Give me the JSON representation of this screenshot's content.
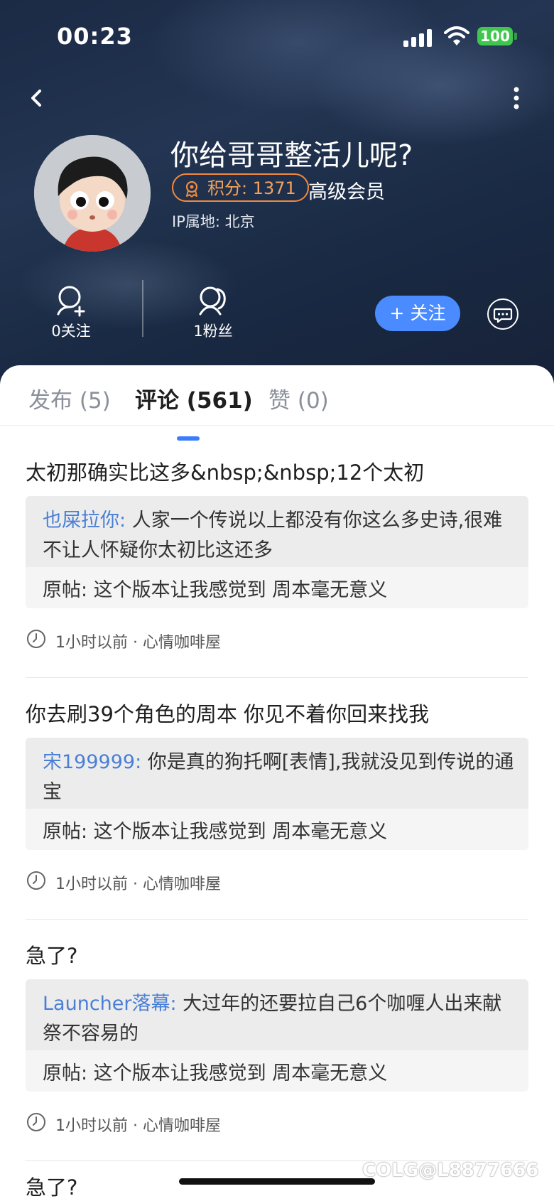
{
  "status_bar": {
    "time": "00:23",
    "battery": "100"
  },
  "profile": {
    "nickname": "你给哥哥整活儿呢?",
    "points": "积分: 1371",
    "level": "高级会员",
    "ip": "IP属地: 北京",
    "following": "0关注",
    "fans": "1粉丝",
    "follow_button": "+ 关注"
  },
  "tabs": [
    {
      "label": "发布 (5)"
    },
    {
      "label": "评论 (561)"
    },
    {
      "label": "赞 (0)"
    }
  ],
  "comments": [
    {
      "text": "太初那确实比这多&nbsp;&nbsp;12个太初",
      "reply_user": "也屎拉你:",
      "reply_text": " 人家一个传说以上都没有你这么多史诗,很难不让人怀疑你太初比这还多",
      "original": "原帖: 这个版本让我感觉到 周本毫无意义",
      "meta": "1小时以前 · 心情咖啡屋"
    },
    {
      "text": "你去刷39个角色的周本 你见不着你回来找我",
      "reply_user": "宋199999:",
      "reply_text": " 你是真的狗托啊[表情],我就没见到传说的通宝",
      "original": "原帖: 这个版本让我感觉到 周本毫无意义",
      "meta": "1小时以前 · 心情咖啡屋"
    },
    {
      "text": "急了?",
      "reply_user": "Launcher落幕:",
      "reply_text": " 大过年的还要拉自己6个咖喱人出来献祭不容易的",
      "original": "原帖: 这个版本让我感觉到 周本毫无意义",
      "meta": "1小时以前 · 心情咖啡屋"
    }
  ],
  "last_comment": "急了?",
  "watermark": "COLG@L8877666",
  "colors": {
    "accent": "#4a8bff",
    "points_orange": "#f28a3c",
    "reply_user": "#4a7fd6"
  }
}
